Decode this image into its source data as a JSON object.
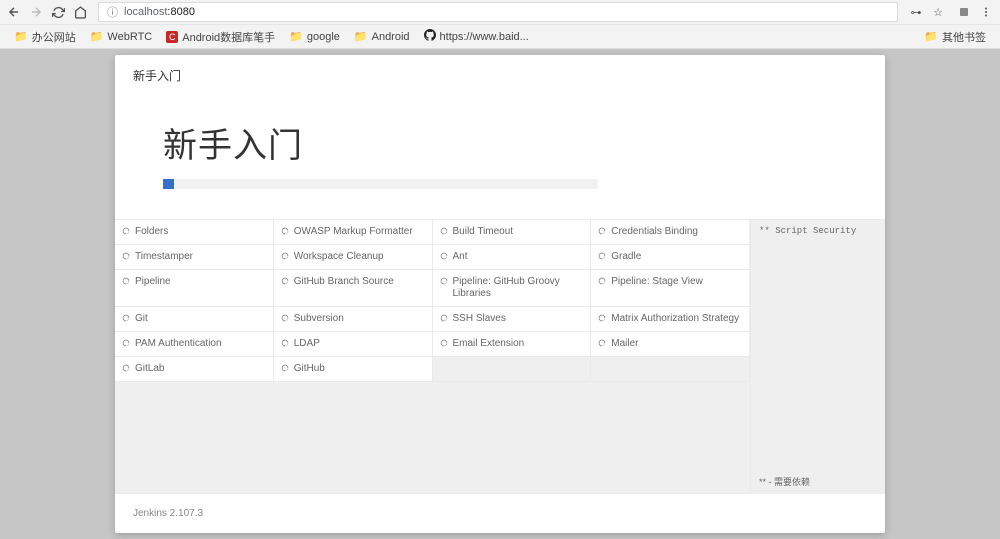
{
  "browser": {
    "url_prefix": "localhost",
    "url_port": ":8080"
  },
  "bookmarks": [
    {
      "label": "办公网站",
      "type": "folder"
    },
    {
      "label": "WebRTC",
      "type": "folder"
    },
    {
      "label": "Android数据库笔手",
      "type": "app"
    },
    {
      "label": "google",
      "type": "folder"
    },
    {
      "label": "Android",
      "type": "folder"
    },
    {
      "label": "https://www.baid...",
      "type": "github"
    }
  ],
  "bookmarks_other": "其他书签",
  "modal": {
    "header": "新手入门",
    "hero_title": "新手入门",
    "footer": "Jenkins 2.107.3",
    "side_top": "** Script Security",
    "side_bottom": "** - 需要依赖"
  },
  "plugins": [
    [
      {
        "name": "Folders",
        "status": "loading"
      },
      {
        "name": "OWASP Markup Formatter",
        "status": "loading"
      },
      {
        "name": "Build Timeout",
        "status": "loading"
      },
      {
        "name": "Credentials Binding",
        "status": "loading"
      }
    ],
    [
      {
        "name": "Timestamper",
        "status": "loading"
      },
      {
        "name": "Workspace Cleanup",
        "status": "loading"
      },
      {
        "name": "Ant",
        "status": "loading"
      },
      {
        "name": "Gradle",
        "status": "loading"
      }
    ],
    [
      {
        "name": "Pipeline",
        "status": "loading"
      },
      {
        "name": "GitHub Branch Source",
        "status": "loading"
      },
      {
        "name": "Pipeline: GitHub Groovy Libraries",
        "status": "loading"
      },
      {
        "name": "Pipeline: Stage View",
        "status": "loading"
      }
    ],
    [
      {
        "name": "Git",
        "status": "loading"
      },
      {
        "name": "Subversion",
        "status": "loading"
      },
      {
        "name": "SSH Slaves",
        "status": "loading"
      },
      {
        "name": "Matrix Authorization Strategy",
        "status": "loading"
      }
    ],
    [
      {
        "name": "PAM Authentication",
        "status": "loading"
      },
      {
        "name": "LDAP",
        "status": "loading"
      },
      {
        "name": "Email Extension",
        "status": "loading"
      },
      {
        "name": "Mailer",
        "status": "loading"
      }
    ],
    [
      {
        "name": "GitLab",
        "status": "loading"
      },
      {
        "name": "GitHub",
        "status": "loading"
      },
      {
        "name": "",
        "status": "empty"
      },
      {
        "name": "",
        "status": "empty"
      }
    ]
  ]
}
